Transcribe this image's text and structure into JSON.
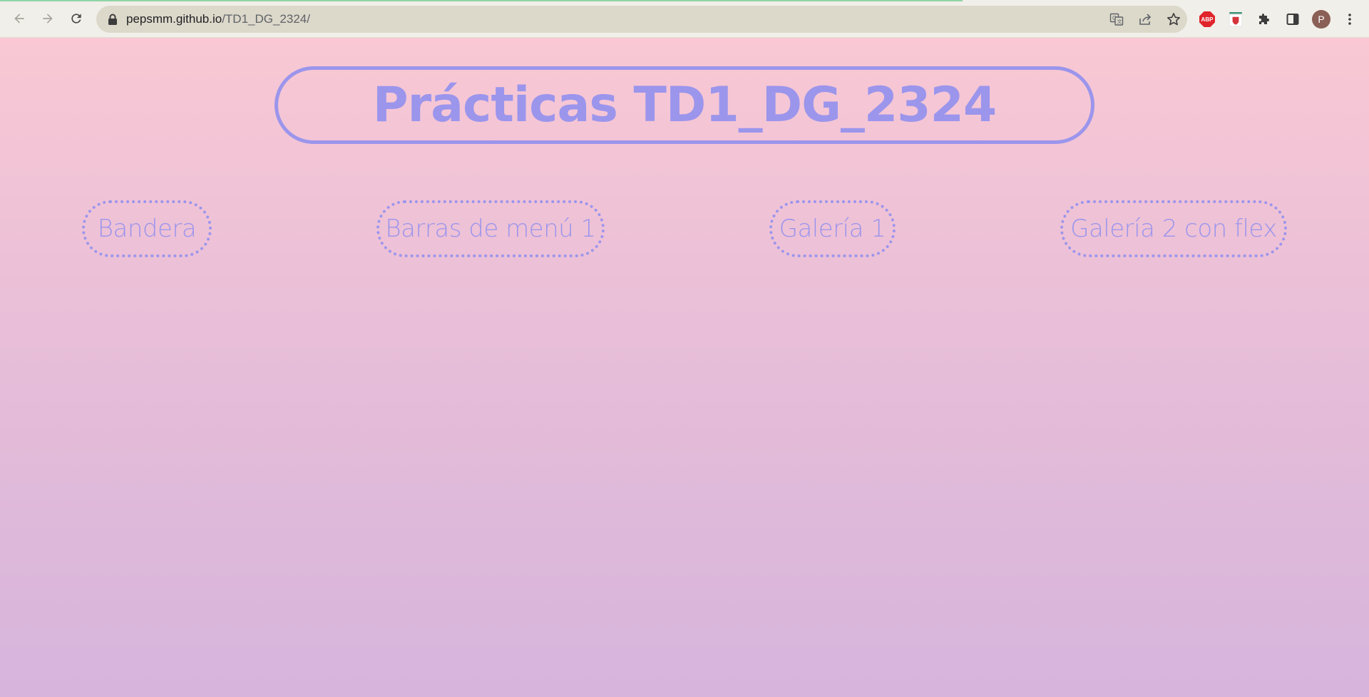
{
  "browser": {
    "url_host": "pepsmm.github.io",
    "url_path": "/TD1_DG_2324/",
    "profile_initial": "P",
    "extensions": [
      "adblock-plus-icon",
      "shield-extension-icon",
      "puzzle-icon"
    ],
    "abp_label": "ABP"
  },
  "page": {
    "title": "Prácticas TD1_DG_2324",
    "links": [
      {
        "label": "Bandera"
      },
      {
        "label": "Barras de menú 1"
      },
      {
        "label": "Galería 1"
      },
      {
        "label": "Galería 2 con flex"
      }
    ],
    "colors": {
      "accent": "#9b95ec",
      "gradient_top": "#f9c8d4",
      "gradient_bottom": "#d6b4dc"
    }
  }
}
